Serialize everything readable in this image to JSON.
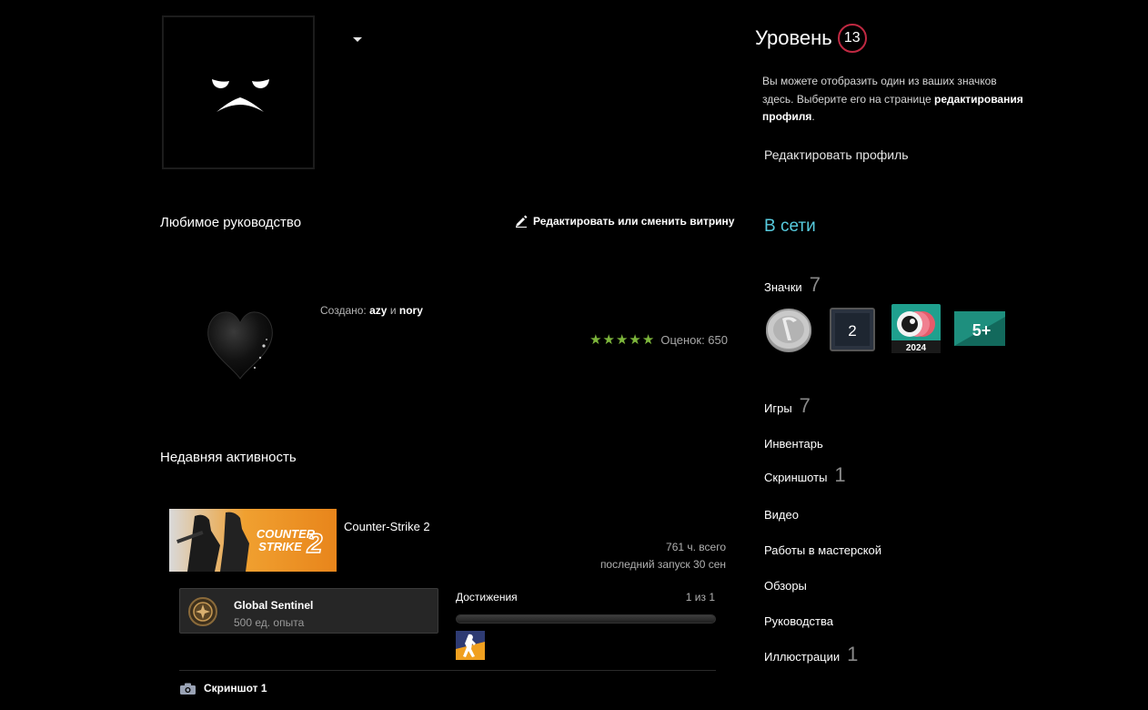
{
  "showcase": {
    "title": "Любимое руководство",
    "edit_label": "Редактировать или сменить витрину",
    "created_prefix": "Создано:",
    "author1": "azy",
    "conj": "и",
    "author2": "nory",
    "stars": "★★★★★",
    "rating_label": "Оценок: 650"
  },
  "activity": {
    "title": "Недавняя активность",
    "game_name": "Counter-Strike 2",
    "capsule_line1": "COUNTER",
    "capsule_line2": "STRIKE",
    "capsule_num": "2",
    "hours_total": "761 ч. всего",
    "last_played": "последний запуск 30 сен",
    "xp_name": "Global Sentinel",
    "xp_sub": "500 ед. опыта",
    "achievements_label": "Достижения",
    "achievements_count": "1 из 1",
    "achievements_progress": 1.0,
    "screenshot_label": "Скриншот 1"
  },
  "sidebar": {
    "level_label": "Уровень",
    "level_value": "13",
    "badge_hint_1": "Вы можете отобразить один из ваших значков здесь. Выберите его на странице",
    "badge_hint_bold": "редактирования профиля",
    "badge_hint_end": ".",
    "edit_profile": "Редактировать профиль",
    "status": "В сети",
    "badges_label": "Значки",
    "badges_count": "7",
    "badge2_text": "2",
    "badge3_year": "2024",
    "badge4_text": "5+",
    "games_label": "Игры",
    "games_count": "7",
    "inventory": "Инвентарь",
    "screenshots_label": "Скриншоты",
    "screenshots_count": "1",
    "videos": "Видео",
    "workshop": "Работы в мастерской",
    "reviews": "Обзоры",
    "guides": "Руководства",
    "artwork_label": "Иллюстрации",
    "artwork_count": "1"
  },
  "colors": {
    "accent_status": "#57cbde",
    "level_ring": "#c02942",
    "stars": "#7db63b",
    "capsule_bg": "#e8851b"
  }
}
